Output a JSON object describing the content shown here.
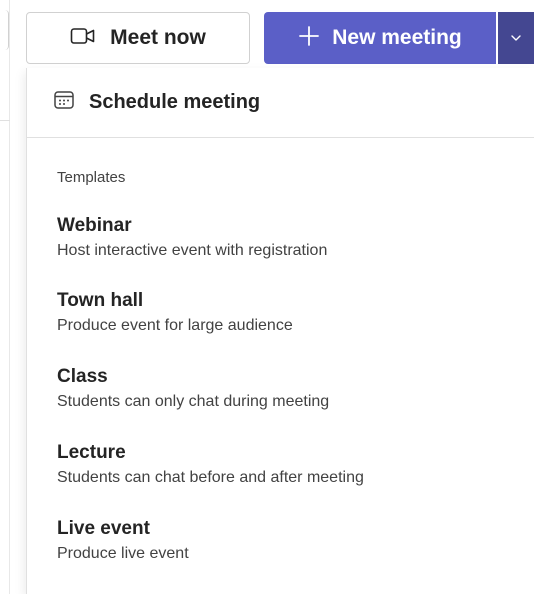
{
  "toolbar": {
    "meet_now_label": "Meet now",
    "meet_now_icon": "video-camera-icon",
    "new_meeting_label": "New meeting",
    "new_meeting_icon": "plus-icon",
    "dropdown_icon": "chevron-down-icon"
  },
  "menu": {
    "schedule_label": "Schedule meeting",
    "schedule_icon": "calendar-icon",
    "templates_header": "Templates",
    "templates": [
      {
        "name": "Webinar",
        "description": "Host interactive event with registration"
      },
      {
        "name": "Town hall",
        "description": "Produce event for large audience"
      },
      {
        "name": "Class",
        "description": "Students can only chat during meeting"
      },
      {
        "name": "Lecture",
        "description": "Students can chat before and after meeting"
      },
      {
        "name": "Live event",
        "description": "Produce live event"
      }
    ]
  },
  "colors": {
    "accent": "#5b5fc7",
    "accent_dark": "#444791"
  }
}
